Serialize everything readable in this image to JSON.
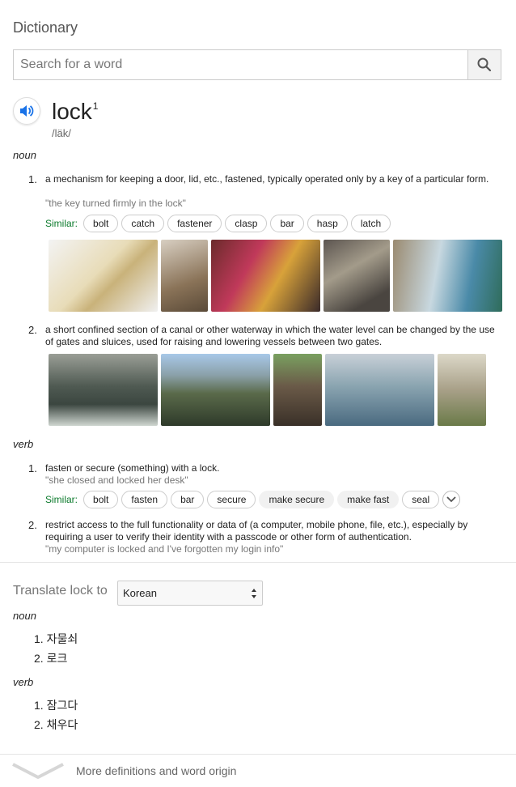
{
  "header": {
    "title": "Dictionary"
  },
  "search": {
    "placeholder": "Search for a word",
    "value": ""
  },
  "entry": {
    "word": "lock",
    "superscript": "1",
    "phonetic": "/läk/"
  },
  "noun": {
    "pos": "noun",
    "senses": [
      {
        "num": "1.",
        "definition": "a mechanism for keeping a door, lid, etc., fastened, typically operated only by a key of a particular form.",
        "example": "\"the key turned firmly in the lock\"",
        "similar_label": "Similar:",
        "similar": [
          "bolt",
          "catch",
          "fastener",
          "clasp",
          "bar",
          "hasp",
          "latch"
        ]
      },
      {
        "num": "2.",
        "definition": "a short confined section of a canal or other waterway in which the water level can be changed by the use of gates and sluices, used for raising and lowering vessels between two gates."
      }
    ]
  },
  "verb": {
    "pos": "verb",
    "senses": [
      {
        "num": "1.",
        "definition": "fasten or secure (something) with a lock.",
        "example": "\"she closed and locked her desk\"",
        "similar_label": "Similar:",
        "similar": [
          "bolt",
          "fasten",
          "bar",
          "secure",
          "make secure",
          "make fast",
          "seal"
        ]
      },
      {
        "num": "2.",
        "definition": "restrict access to the full functionality or data of (a computer, mobile phone, file, etc.), especially by requiring a user to verify their identity with a passcode or other form of authentication.",
        "example": "\"my computer is locked and I've forgotten my login info\""
      }
    ]
  },
  "translate": {
    "label": "Translate lock to",
    "language": "Korean",
    "noun_label": "noun",
    "noun": [
      {
        "num": "1.",
        "text": "자물쇠"
      },
      {
        "num": "2.",
        "text": "로크"
      }
    ],
    "verb_label": "verb",
    "verb": [
      {
        "num": "1.",
        "text": "잠그다"
      },
      {
        "num": "2.",
        "text": "채우다"
      }
    ]
  },
  "footer": {
    "more": "More definitions and word origin"
  },
  "icons": {
    "search": "search-icon",
    "speaker": "speaker-icon",
    "expand": "chevron-down-icon",
    "more": "chevron-down-icon"
  },
  "colors": {
    "similar_label": "#0b7a2c",
    "speaker": "#1a73e8"
  }
}
